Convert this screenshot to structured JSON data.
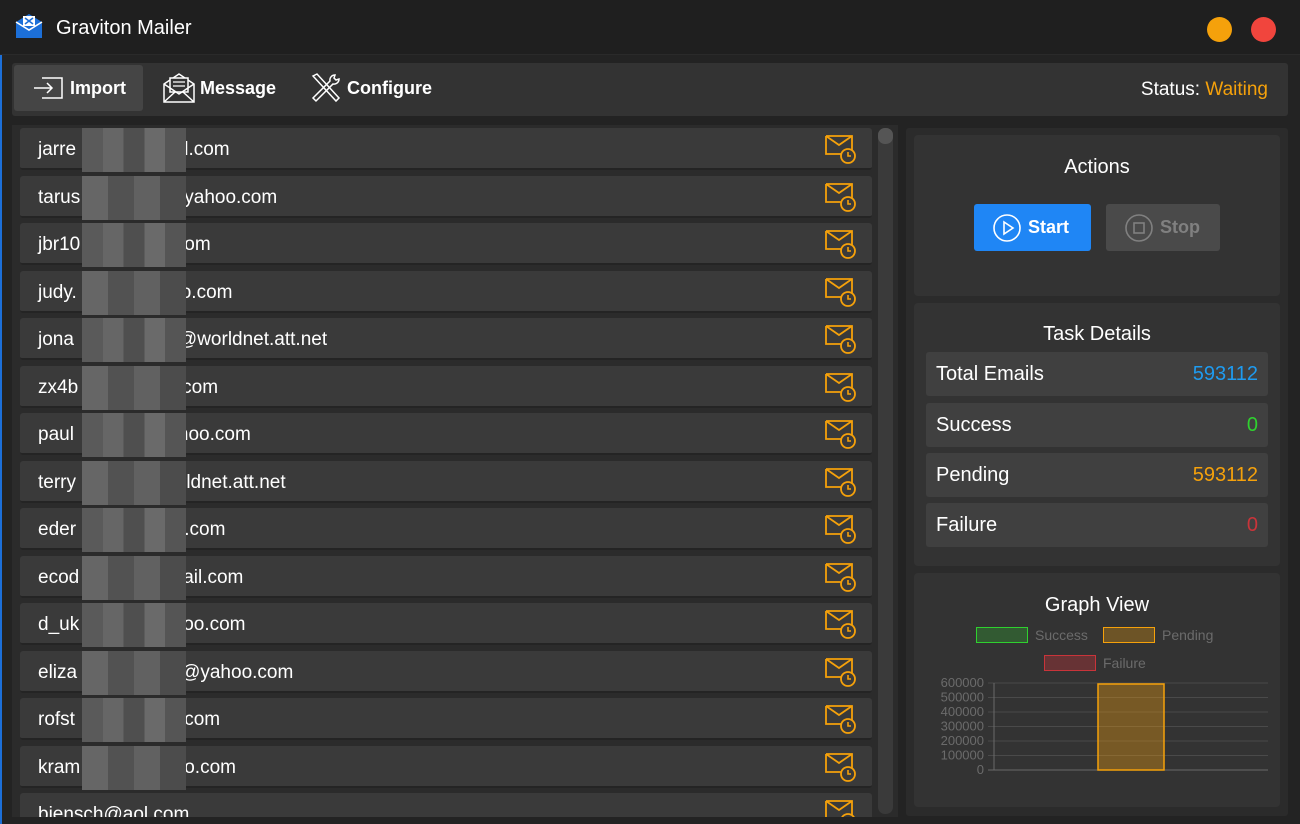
{
  "window": {
    "title": "Graviton Mailer",
    "icon": "envelope-app-icon"
  },
  "toolbar": {
    "import_label": "Import",
    "message_label": "Message",
    "configure_label": "Configure",
    "status_label": "Status:",
    "status_value": "Waiting"
  },
  "emails": [
    "jarre",
    "il.com",
    "tarus",
    "yahoo.com",
    "jbr10",
    "om",
    "judy.",
    "o.com",
    "jona",
    "@worldnet.att.net",
    "zx4b",
    "com",
    "paul",
    "hoo.com",
    "terry",
    "rldnet.att.net",
    "eder",
    "l.com",
    "ecod",
    "ail.com",
    "d_uk",
    "oo.com",
    "eliza",
    "@yahoo.com",
    "rofst",
    ".com",
    "kram",
    "o.com",
    "bjensch@aol.com"
  ],
  "actions": {
    "title": "Actions",
    "start_label": "Start",
    "stop_label": "Stop"
  },
  "task_details": {
    "title": "Task Details",
    "rows": [
      {
        "label": "Total Emails",
        "value": "593112",
        "color": "#1e9bf0"
      },
      {
        "label": "Success",
        "value": "0",
        "color": "#2fd12f"
      },
      {
        "label": "Pending",
        "value": "593112",
        "color": "#f5a10b"
      },
      {
        "label": "Failure",
        "value": "0",
        "color": "#c9343a"
      }
    ]
  },
  "colors": {
    "accent": "#1f86f5",
    "pending": "#f5a10b",
    "success": "#2fd12f",
    "failure": "#c9343a"
  },
  "chart_data": {
    "title": "Graph View",
    "type": "bar",
    "series": [
      {
        "name": "Success",
        "value": 0,
        "color": "#2fd12f"
      },
      {
        "name": "Pending",
        "value": 593112,
        "color": "#f5a10b"
      },
      {
        "name": "Failure",
        "value": 0,
        "color": "#c9343a"
      }
    ],
    "yticks": [
      "600000",
      "500000",
      "400000",
      "300000",
      "200000",
      "100000",
      "0"
    ],
    "ylim": [
      0,
      600000
    ],
    "legend": "top"
  }
}
